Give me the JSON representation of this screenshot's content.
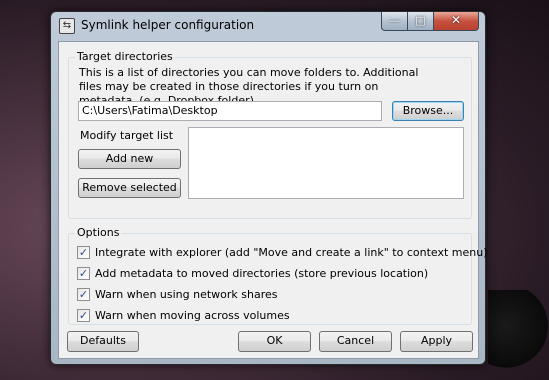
{
  "window": {
    "title": "Symlink helper configuration",
    "minimize_glyph": "—",
    "maximize_glyph": "□",
    "close_glyph": "✕"
  },
  "target_directories": {
    "group_label": "Target directories",
    "description": "This is a list of directories you can move folders to. Additional files may be created in those directories if you turn on metadata. (e.g. Dropbox folder)",
    "path_value": "C:\\Users\\Fatima\\Desktop",
    "browse_label": "Browse...",
    "modify_label": "Modify target list",
    "add_new_label": "Add new",
    "remove_selected_label": "Remove selected",
    "target_list": []
  },
  "options": {
    "group_label": "Options",
    "items": [
      {
        "label": "Integrate with explorer (add \"Move and create a link\" to context menu)",
        "checked": true
      },
      {
        "label": "Add metadata to moved directories (store previous location)",
        "checked": true
      },
      {
        "label": "Warn when using network shares",
        "checked": true
      },
      {
        "label": "Warn when moving across volumes",
        "checked": true
      }
    ]
  },
  "footer": {
    "defaults_label": "Defaults",
    "ok_label": "OK",
    "cancel_label": "Cancel",
    "apply_label": "Apply"
  },
  "colors": {
    "accent_focus": "#3c7fb1",
    "close_button": "#c75140",
    "dialog_bg": "#f0f0f0"
  }
}
